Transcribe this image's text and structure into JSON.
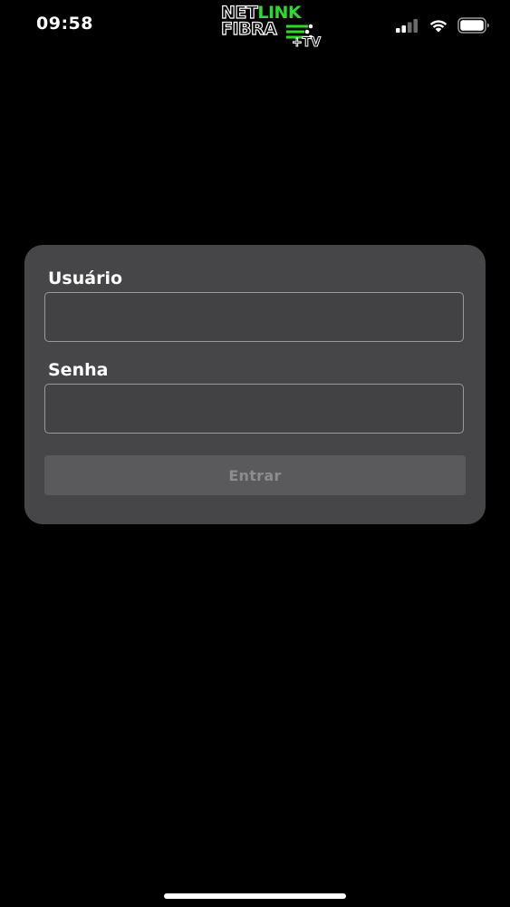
{
  "status_bar": {
    "time": "09:58",
    "signal_icon": "cellular-signal-icon",
    "wifi_icon": "wifi-icon",
    "battery_icon": "battery-icon"
  },
  "logo": {
    "word_net": "NET",
    "word_link": "LINK",
    "word_fibra": "FIBRA",
    "word_tv": "+TV",
    "accent_color": "#2bdc2b"
  },
  "login_form": {
    "username_label": "Usuário",
    "username_value": "",
    "password_label": "Senha",
    "password_value": "",
    "submit_label": "Entrar"
  },
  "colors": {
    "background": "#000000",
    "card": "#464548",
    "button_disabled": "#5a595c",
    "button_text_disabled": "#8d8c8f"
  }
}
